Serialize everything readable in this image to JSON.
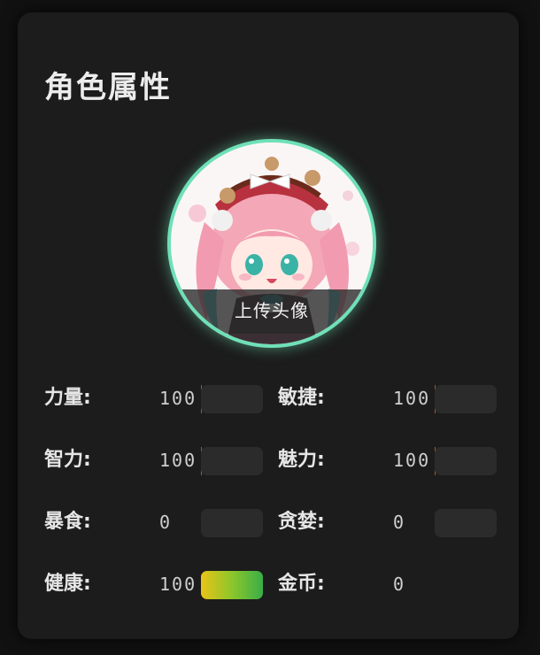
{
  "panel": {
    "title": "角色属性"
  },
  "avatar": {
    "upload_label": "上传头像",
    "border_color": "#6fe0b8"
  },
  "stats": [
    {
      "label": "力量:",
      "value": "100",
      "input_value": ""
    },
    {
      "label": "敏捷:",
      "value": "100",
      "input_value": ""
    },
    {
      "label": "智力:",
      "value": "100",
      "input_value": ""
    },
    {
      "label": "魅力:",
      "value": "100",
      "input_value": ""
    },
    {
      "label": "暴食:",
      "value": "0",
      "input_value": ""
    },
    {
      "label": "贪婪:",
      "value": "0",
      "input_value": ""
    },
    {
      "label": "健康:",
      "value": "100",
      "bar_fill_fraction": 1.0,
      "bar_colors": [
        "#e9c418",
        "#3aae48"
      ]
    },
    {
      "label": "金币:",
      "value": "0"
    }
  ]
}
